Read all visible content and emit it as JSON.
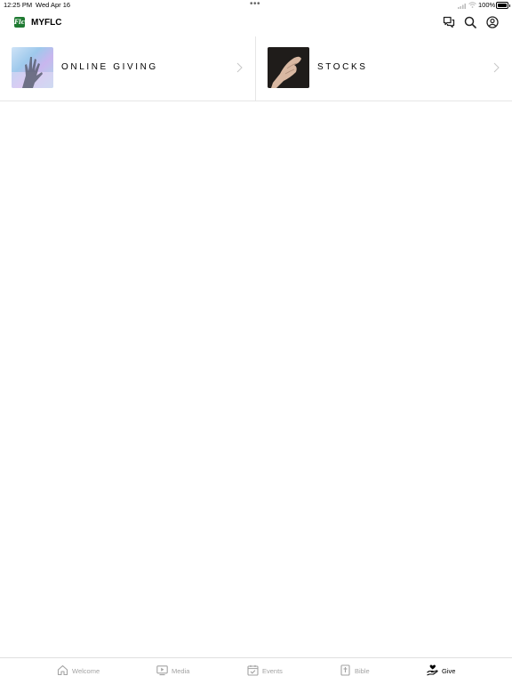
{
  "status_bar": {
    "time": "12:25 PM",
    "date": "Wed Apr 16",
    "battery": "100%"
  },
  "header": {
    "logo_text": "Flc",
    "app_title": "MYFLC",
    "icons": [
      "chat-icon",
      "search-icon",
      "profile-icon"
    ]
  },
  "cards": [
    {
      "label": "ONLINE GIVING",
      "icon": "chevron-right-icon"
    },
    {
      "label": "STOCKS",
      "icon": "chevron-right-icon"
    }
  ],
  "tabs": [
    {
      "label": "Welcome",
      "icon": "home-icon",
      "active": false
    },
    {
      "label": "Media",
      "icon": "play-icon",
      "active": false
    },
    {
      "label": "Events",
      "icon": "calendar-icon",
      "active": false
    },
    {
      "label": "Bible",
      "icon": "bible-icon",
      "active": false
    },
    {
      "label": "Give",
      "icon": "give-icon",
      "active": true
    }
  ],
  "colors": {
    "logo_green": "#1f7a32",
    "inactive_tab": "#a3a3a3",
    "divider": "#e6e6e6"
  }
}
